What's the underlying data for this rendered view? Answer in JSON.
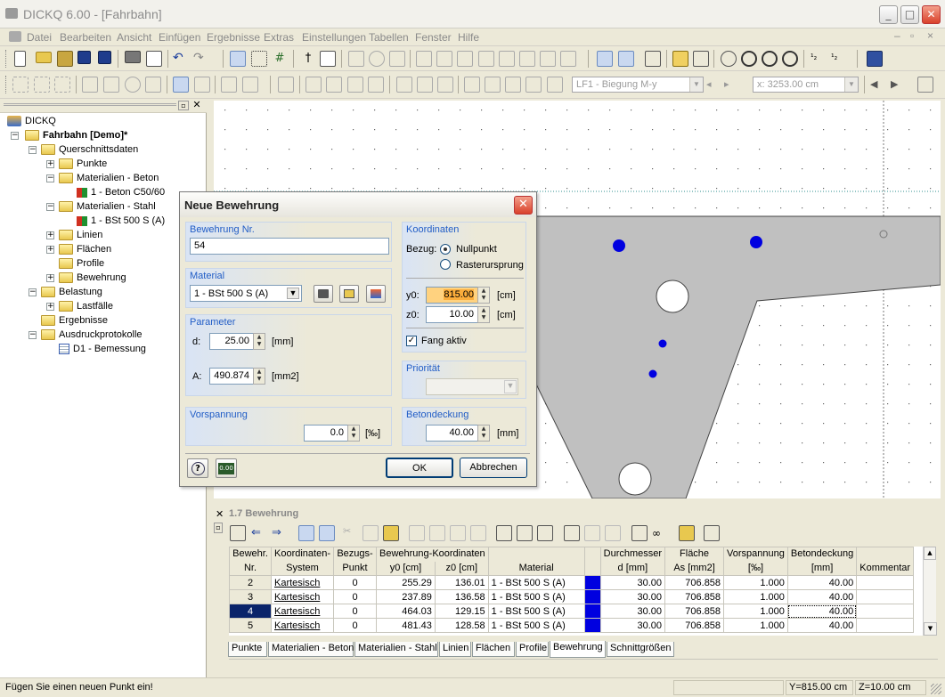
{
  "window": {
    "title": "DICKQ 6.00 - [Fahrbahn]"
  },
  "menu": [
    "Datei",
    "Bearbeiten",
    "Ansicht",
    "Einfügen",
    "Ergebnisse",
    "Extras",
    "Einstellungen",
    "Tabellen",
    "Fenster",
    "Hilfe"
  ],
  "toolbar": {
    "loadcase": "LF1 - Biegung M-y",
    "coord": "x: 3253.00 cm"
  },
  "tree": {
    "root": "DICKQ",
    "project": "Fahrbahn [Demo]*",
    "items": [
      "Querschnittsdaten",
      "Punkte",
      "Materialien - Beton",
      "1 - Beton C50/60",
      "Materialien - Stahl",
      "1 - BSt 500 S (A)",
      "Linien",
      "Flächen",
      "Profile",
      "Bewehrung",
      "Belastung",
      "Lastfälle",
      "Ergebnisse",
      "Ausdruckprotokolle",
      "D1 - Bemessung"
    ]
  },
  "dialog": {
    "title": "Neue Bewehrung",
    "nr_label": "Bewehrung Nr.",
    "nr_value": "54",
    "material_label": "Material",
    "material_value": "1 - BSt 500 S (A)",
    "param_label": "Parameter",
    "d_label": "d:",
    "d_value": "25.00",
    "d_unit": "[mm]",
    "a_label": "A:",
    "a_value": "490.874",
    "a_unit": "[mm2]",
    "vorspannung_label": "Vorspannung",
    "vorspannung_value": "0.0",
    "vorspannung_unit": "[‰]",
    "koord_label": "Koordinaten",
    "bezug_label": "Bezug:",
    "radio_null": "Nullpunkt",
    "radio_raster": "Rasterursprung",
    "y0_label": "y0:",
    "y0_value": "815.00",
    "y0_unit": "[cm]",
    "z0_label": "z0:",
    "z0_value": "10.00",
    "z0_unit": "[cm]",
    "fang_label": "Fang aktiv",
    "prio_label": "Priorität",
    "beton_label": "Betondeckung",
    "beton_value": "40.00",
    "beton_unit": "[mm]",
    "ok": "OK",
    "cancel": "Abbrechen",
    "calc_icon_text": "0.00"
  },
  "panel": {
    "title": "1.7 Bewehrung",
    "headers": [
      [
        "Bewehr.",
        "Nr."
      ],
      [
        "Koordinaten-",
        "System"
      ],
      [
        "Bezugs-",
        "Punkt"
      ],
      [
        "Bewehrung-Koordinaten",
        "y0 [cm]"
      ],
      [
        "",
        "z0 [cm]"
      ],
      [
        "",
        "Material"
      ],
      [
        "",
        ""
      ],
      [
        "Durchmesser",
        "d [mm]"
      ],
      [
        "Fläche",
        "As [mm2]"
      ],
      [
        "Vorspannung",
        "[‰]"
      ],
      [
        "Betondeckung",
        "[mm]"
      ],
      [
        "",
        "Kommentar"
      ]
    ],
    "rows": [
      [
        "2",
        "Kartesisch",
        "0",
        "255.29",
        "136.01",
        "1 - BSt 500 S (A)",
        "",
        "30.00",
        "706.858",
        "1.000",
        "40.00",
        ""
      ],
      [
        "3",
        "Kartesisch",
        "0",
        "237.89",
        "136.58",
        "1 - BSt 500 S (A)",
        "",
        "30.00",
        "706.858",
        "1.000",
        "40.00",
        ""
      ],
      [
        "4",
        "Kartesisch",
        "0",
        "464.03",
        "129.15",
        "1 - BSt 500 S (A)",
        "",
        "30.00",
        "706.858",
        "1.000",
        "40.00",
        ""
      ],
      [
        "5",
        "Kartesisch",
        "0",
        "481.43",
        "128.58",
        "1 - BSt 500 S (A)",
        "",
        "30.00",
        "706.858",
        "1.000",
        "40.00",
        ""
      ]
    ],
    "tabs": [
      "Punkte",
      "Materialien - Beton",
      "Materialien - Stahl",
      "Linien",
      "Flächen",
      "Profile",
      "Bewehrung",
      "Schnittgrößen"
    ],
    "active_tab": "Bewehrung"
  },
  "status": {
    "message": "Fügen Sie einen neuen Punkt ein!",
    "y": "Y=815.00 cm",
    "z": "Z=10.00 cm"
  },
  "colors": {
    "rebar": "#0000e0",
    "concrete": "#c0c0c0",
    "accent": "#215dc6",
    "highlight": "#ffd27f"
  }
}
